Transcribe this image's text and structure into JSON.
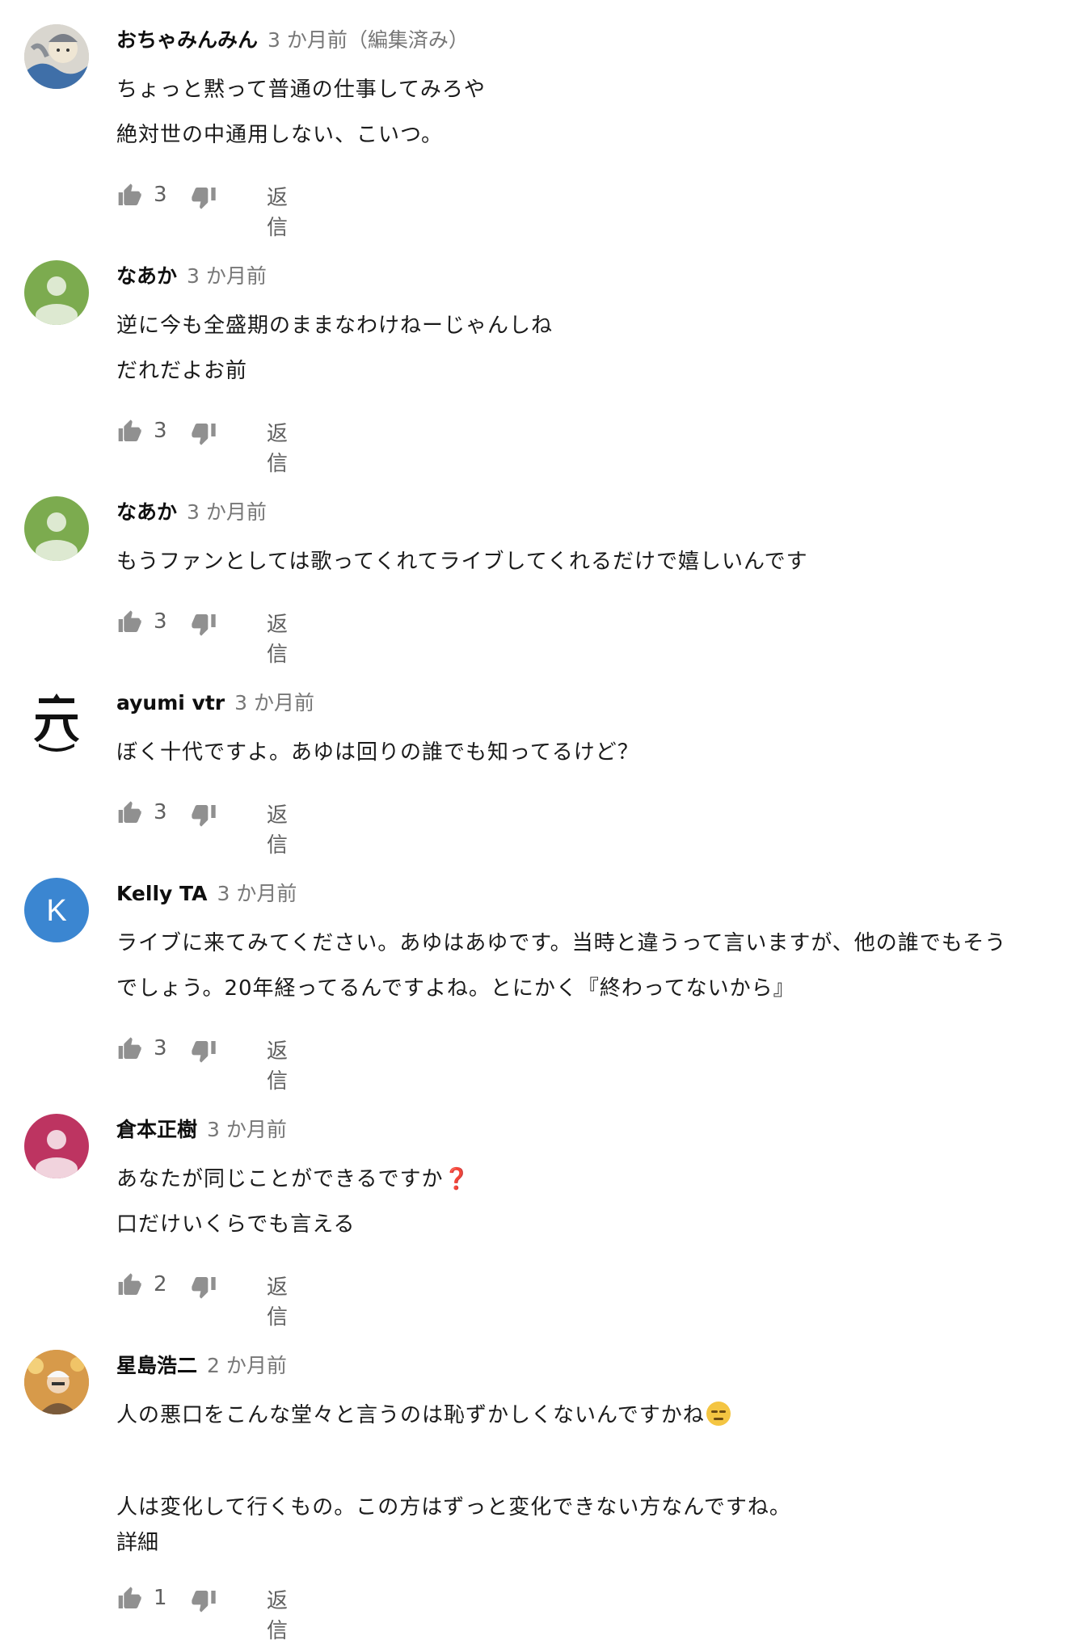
{
  "comments": [
    {
      "author": "おちゃみんみん",
      "time": "3 か月前（編集済み）",
      "lines": [
        "ちょっと黙って普通の仕事してみろや",
        "絶対世の中通用しない、こいつ。"
      ],
      "likes": "3",
      "reply": "返信",
      "avatar": "illustration-avatar"
    },
    {
      "author": "なあか",
      "time": "3 か月前",
      "lines": [
        "逆に今も全盛期のままなわけねーじゃんしね",
        "だれだよお前"
      ],
      "likes": "3",
      "reply": "返信",
      "avatar": "default-avatar",
      "avatar_color": "#7cab4f"
    },
    {
      "author": "なあか",
      "time": "3 か月前",
      "lines": [
        "もうファンとしては歌ってくれてライブしてくれるだけで嬉しいんです"
      ],
      "likes": "3",
      "reply": "返信",
      "avatar": "default-avatar",
      "avatar_color": "#7cab4f"
    },
    {
      "author": "ayumi vtr",
      "time": "3 か月前",
      "lines": [
        "ぼく十代ですよ。あゆは回りの誰でも知ってるけど？"
      ],
      "likes": "3",
      "reply": "返信",
      "avatar": "ayu-logo-avatar"
    },
    {
      "author": "Kelly TA",
      "time": "3 か月前",
      "lines": [
        "ライブに来てみてください。あゆはあゆです。当時と違うって言いますが、他の誰でもそう",
        "でしょう。20年経ってるんですよね。とにかく『終わってないから』"
      ],
      "likes": "3",
      "reply": "返信",
      "avatar": "letter-avatar",
      "avatar_letter": "K",
      "avatar_color": "#3b86d1"
    },
    {
      "author": "倉本正樹",
      "time": "3 か月前",
      "lines": [
        "あなたが同じことができるですか",
        "口だけいくらでも言える"
      ],
      "emoji_after_line1": "❓",
      "likes": "2",
      "reply": "返信",
      "avatar": "default-avatar",
      "avatar_color": "#bd3461"
    },
    {
      "author": "星島浩二",
      "time": "2 か月前",
      "lines": [
        "人の悪口をこんな堂々と言うのは恥ずかしくないんですかね",
        "人は変化して行くもの。この方はずっと変化できない方なんですね。"
      ],
      "emoji_after_line1": "expressionless-face",
      "more": "詳細",
      "likes": "1",
      "reply": "返信",
      "avatar": "photo-avatar"
    }
  ],
  "icons": {
    "like": "thumbs-up-icon",
    "dislike": "thumbs-down-icon"
  },
  "colors": {
    "meta_gray": "#777777",
    "action_gray": "#606060"
  }
}
